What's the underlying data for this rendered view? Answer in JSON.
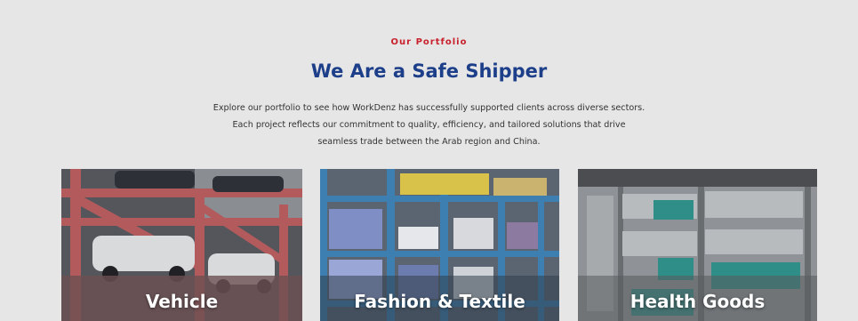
{
  "portfolio": {
    "eyebrow": "Our Portfolio",
    "title": "We Are a Safe Shipper",
    "description_lines": [
      "Explore our portfolio to see how WorkDenz has successfully supported clients across diverse sectors.",
      "Each project reflects our commitment to quality, efficiency, and tailored solutions that drive",
      "seamless trade between the Arab region and China."
    ]
  },
  "cards": [
    {
      "label": "Vehicle",
      "image": "car-carrier-photo"
    },
    {
      "label": "Fashion & Textile",
      "image": "textile-warehouse-photo"
    },
    {
      "label": "Health Goods",
      "image": "medical-supplies-warehouse-photo"
    }
  ],
  "colors": {
    "eyebrow": "#c8202c",
    "title": "#1d3f8a",
    "background": "#e6e6e6"
  }
}
